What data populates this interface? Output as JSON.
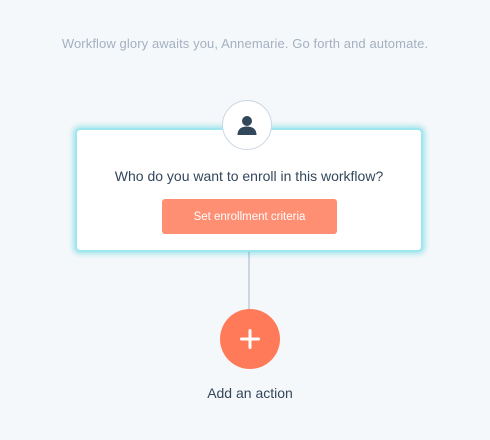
{
  "header": {
    "tagline": "Workflow glory awaits you, Annemarie. Go forth and automate."
  },
  "enrollment_trigger": {
    "avatar_icon": "contact-person-icon",
    "question": "Who do you want to enroll in this workflow?",
    "button_label": "Set enrollment criteria"
  },
  "add_action": {
    "icon": "plus-icon",
    "label": "Add an action"
  },
  "colors": {
    "background": "#f5f8fa",
    "accent_orange": "#ff7a59",
    "button_orange": "#ff8f73",
    "trigger_highlight": "#00bdd0",
    "text_dark": "#33475b",
    "text_muted": "#a3b1c2"
  }
}
